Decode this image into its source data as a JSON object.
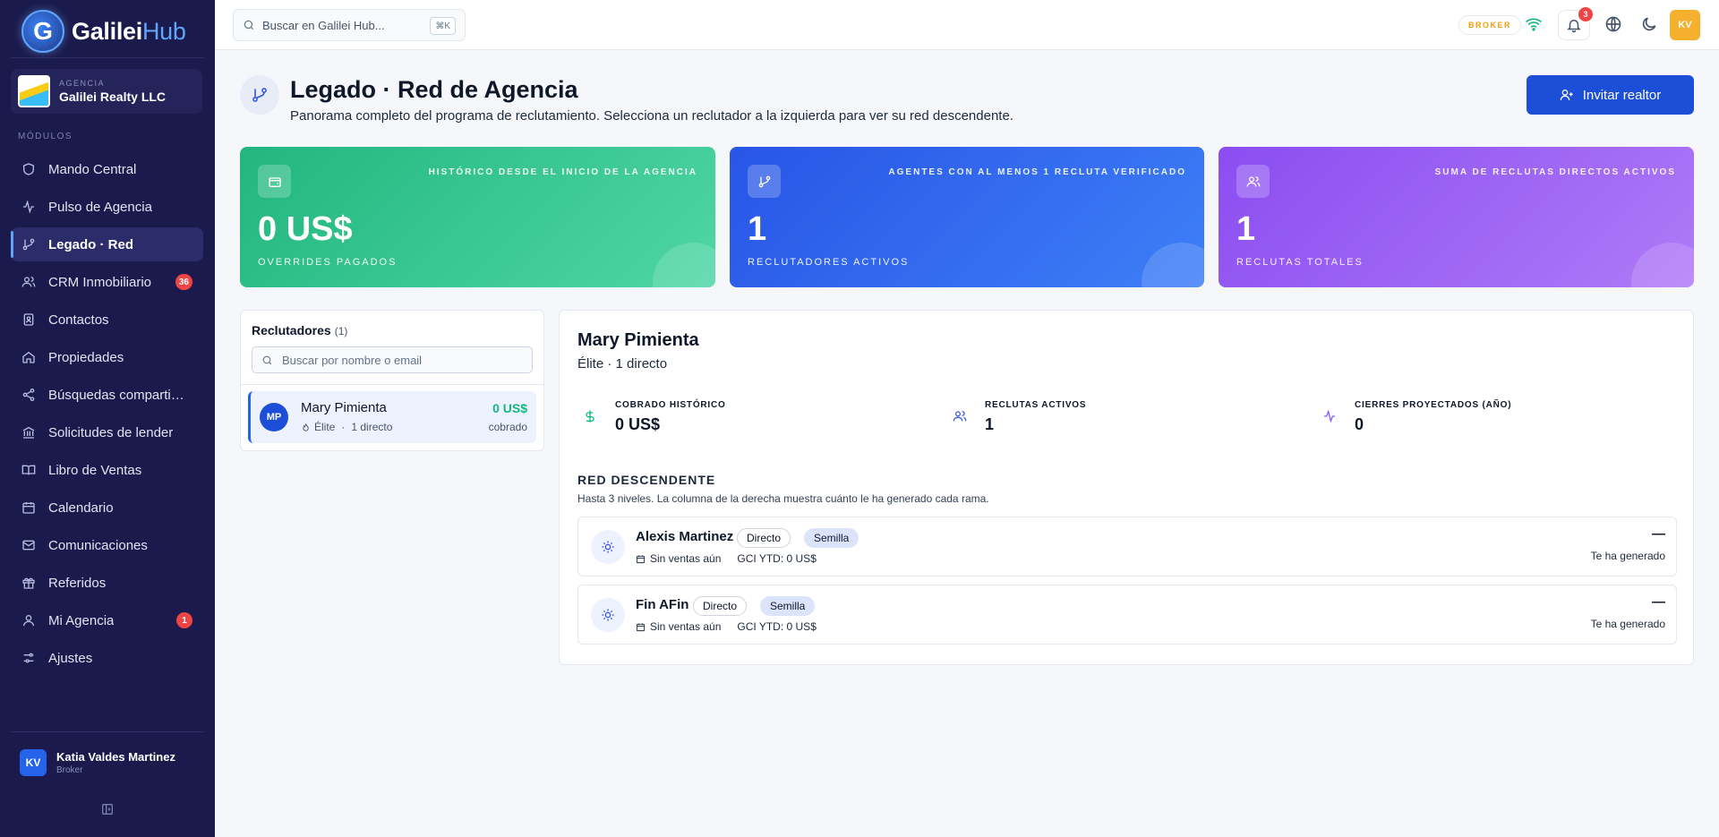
{
  "app": {
    "logo_letter": "G",
    "name_main": "Galilei",
    "name_accent": "Hub"
  },
  "agency": {
    "kicker": "AGENCIA",
    "name": "Galilei Realty LLC"
  },
  "sidebar": {
    "section_label": "MÓDULOS",
    "items": [
      {
        "label": "Mando Central",
        "icon": "shield-icon"
      },
      {
        "label": "Pulso de Agencia",
        "icon": "activity-icon"
      },
      {
        "label": "Legado · Red",
        "icon": "git-branch-icon",
        "active": true
      },
      {
        "label": "CRM Inmobiliario",
        "icon": "users-icon",
        "badge": "36"
      },
      {
        "label": "Contactos",
        "icon": "contacts-icon"
      },
      {
        "label": "Propiedades",
        "icon": "home-icon"
      },
      {
        "label": "Búsquedas compartidas",
        "icon": "share-icon"
      },
      {
        "label": "Solicitudes de lender",
        "icon": "bank-icon"
      },
      {
        "label": "Libro de Ventas",
        "icon": "book-icon"
      },
      {
        "label": "Calendario",
        "icon": "calendar-icon"
      },
      {
        "label": "Comunicaciones",
        "icon": "mail-icon"
      },
      {
        "label": "Referidos",
        "icon": "gift-icon"
      },
      {
        "label": "Mi Agencia",
        "icon": "user-icon",
        "badge": "1"
      },
      {
        "label": "Ajustes",
        "icon": "sliders-icon"
      }
    ]
  },
  "user": {
    "initials": "KV",
    "name": "Katia Valdes Martinez",
    "role": "Broker"
  },
  "topbar": {
    "search_placeholder": "Buscar en Galilei Hub...",
    "shortcut": "⌘K",
    "role_pill": "BROKER",
    "notifications_count": "3",
    "avatar_initials": "KV"
  },
  "page": {
    "title": "Legado · Red de Agencia",
    "subtitle": "Panorama completo del programa de reclutamiento. Selecciona un reclutador a la izquierda para ver su red descendente.",
    "invite_label": "Invitar realtor"
  },
  "stats": [
    {
      "note": "HISTÓRICO DESDE EL INICIO DE LA AGENCIA",
      "value": "0 US$",
      "label": "OVERRIDES PAGADOS",
      "icon": "wallet-icon"
    },
    {
      "note": "AGENTES CON AL MENOS 1 RECLUTA VERIFICADO",
      "value": "1",
      "label": "RECLUTADORES ACTIVOS",
      "icon": "git-branch-icon"
    },
    {
      "note": "SUMA DE RECLUTAS DIRECTOS ACTIVOS",
      "value": "1",
      "label": "RECLUTAS TOTALES",
      "icon": "users-icon"
    }
  ],
  "recruiters": {
    "title": "Reclutadores",
    "count": "(1)",
    "search_placeholder": "Buscar por nombre o email",
    "items": [
      {
        "initials": "MP",
        "name": "Mary Pimienta",
        "tier": "Élite",
        "directs": "1 directo",
        "amount": "0 US$",
        "amount_label": "cobrado"
      }
    ]
  },
  "detail": {
    "name": "Mary Pimienta",
    "subtitle": "Élite · 1 directo",
    "metrics": [
      {
        "label": "COBRADO HISTÓRICO",
        "value": "0 US$",
        "icon": "dollar-icon",
        "color": "#10b981"
      },
      {
        "label": "RECLUTAS ACTIVOS",
        "value": "1",
        "icon": "users-icon",
        "color": "#3b5bdb"
      },
      {
        "label": "CIERRES PROYECTADOS (AÑO)",
        "value": "0",
        "icon": "activity-icon",
        "color": "#8b5cf6"
      }
    ],
    "network_title": "RED DESCENDENTE",
    "network_subtitle": "Hasta 3 niveles. La columna de la derecha muestra cuánto le ha generado cada rama.",
    "branches": [
      {
        "name": "Alexis Martinez",
        "tag1": "Directo",
        "tag2": "Semilla",
        "sales": "Sin ventas aún",
        "gci": "GCI YTD: 0 US$",
        "dash": "—",
        "right_label": "Te ha generado"
      },
      {
        "name": "Fin AFin",
        "tag1": "Directo",
        "tag2": "Semilla",
        "sales": "Sin ventas aún",
        "gci": "GCI YTD: 0 US$",
        "dash": "—",
        "right_label": "Te ha generado"
      }
    ]
  },
  "colors": {
    "sidebar_bg": "#1b1a4c",
    "accent": "#1d4ed8",
    "success": "#10b981",
    "badge": "#ef4444",
    "card_green": "#22b67e",
    "card_blue": "#2855e6",
    "card_purple": "#8b4df1"
  }
}
